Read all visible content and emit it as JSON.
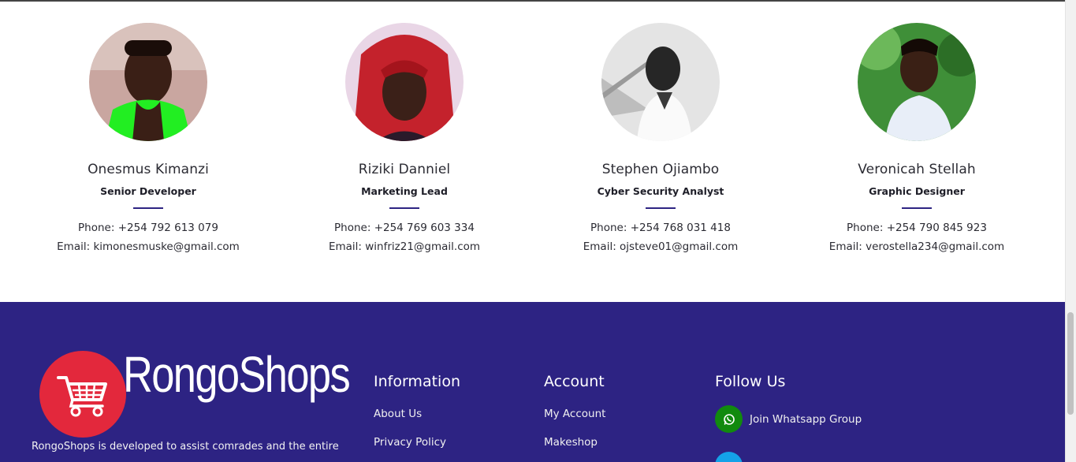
{
  "team": [
    {
      "name": "Onesmus Kimanzi",
      "role": "Senior Developer",
      "phone": "Phone: +254 792 613 079",
      "email": "Email: kimonesmuske@gmail.com"
    },
    {
      "name": "Riziki Danniel",
      "role": "Marketing Lead",
      "phone": "Phone: +254 769 603 334",
      "email": "Email: winfriz21@gmail.com"
    },
    {
      "name": "Stephen Ojiambo",
      "role": "Cyber Security Analyst",
      "phone": "Phone: +254 768 031 418",
      "email": "Email: ojsteve01@gmail.com"
    },
    {
      "name": "Veronicah Stellah",
      "role": "Graphic Designer",
      "phone": "Phone: +254 790 845 923",
      "email": "Email: verostella234@gmail.com"
    }
  ],
  "footer": {
    "brand": "RongoShops",
    "description": "RongoShops is developed to assist comrades and the entire",
    "information": {
      "title": "Information",
      "links": [
        "About Us",
        "Privacy Policy"
      ]
    },
    "account": {
      "title": "Account",
      "links": [
        "My Account",
        "Makeshop"
      ]
    },
    "follow": {
      "title": "Follow Us",
      "whatsapp_label": "Join Whatsapp Group"
    }
  },
  "icons": {
    "logo": "shopping-cart-icon",
    "whatsapp": "whatsapp-icon",
    "second_social": "twitter-icon"
  },
  "colors": {
    "footer_bg": "#2d2383",
    "logo_red": "#e3283c",
    "whatsapp_green": "#118a0e",
    "accent_rule": "#2e2483"
  }
}
